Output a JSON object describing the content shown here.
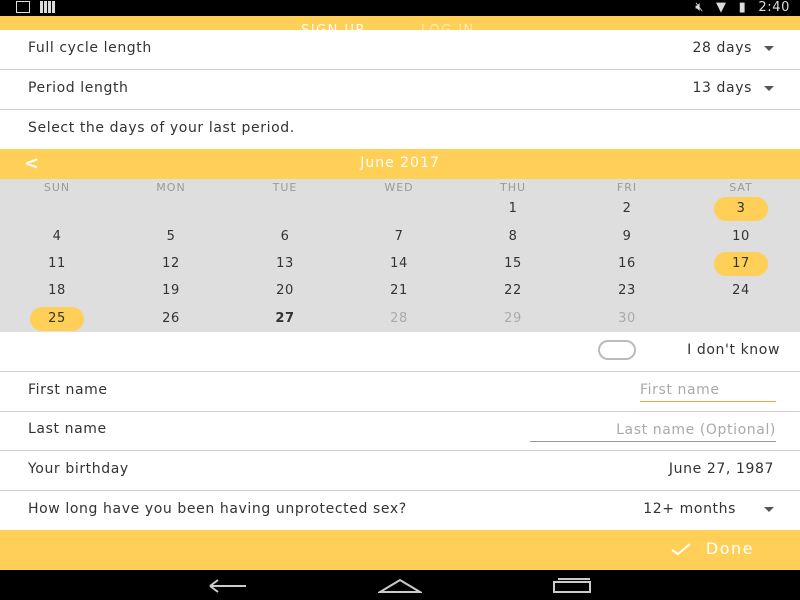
{
  "status_bar": {
    "icons": [
      "download-icon",
      "bars-icon",
      "mute-icon",
      "wifi-icon",
      "battery-icon"
    ],
    "time": "2:40"
  },
  "tabs": {
    "signup": "SIGN UP",
    "login": "LOG IN"
  },
  "cycle_row": {
    "label": "Full cycle length",
    "value": "28 days"
  },
  "period_row": {
    "label": "Period length",
    "value": "13 days"
  },
  "instruction": "Select the days of your last period.",
  "calendar": {
    "month": "June 2017",
    "weekdays": [
      "SUN",
      "MON",
      "TUE",
      "WED",
      "THU",
      "FRI",
      "SAT"
    ],
    "first_day_column": 4,
    "days_in_month": 30,
    "selected_days": [
      3,
      17,
      25
    ],
    "today": 27,
    "disabled_from": 28
  },
  "dont_know_label": "I don't know",
  "first_name": {
    "label": "First name",
    "placeholder": "First name",
    "value": ""
  },
  "last_name": {
    "label": "Last name",
    "placeholder": "Last name (Optional)",
    "value": ""
  },
  "birthday": {
    "label": "Your birthday",
    "value": "June 27, 1987"
  },
  "unprotected": {
    "label": "How long have you been having unprotected sex?",
    "value": "12+ months"
  },
  "footer": {
    "done_label": "Done"
  },
  "colors": {
    "accent": "#ffcf57",
    "tab_underline": "#f5a04a",
    "calendar_bg": "#dedede"
  }
}
